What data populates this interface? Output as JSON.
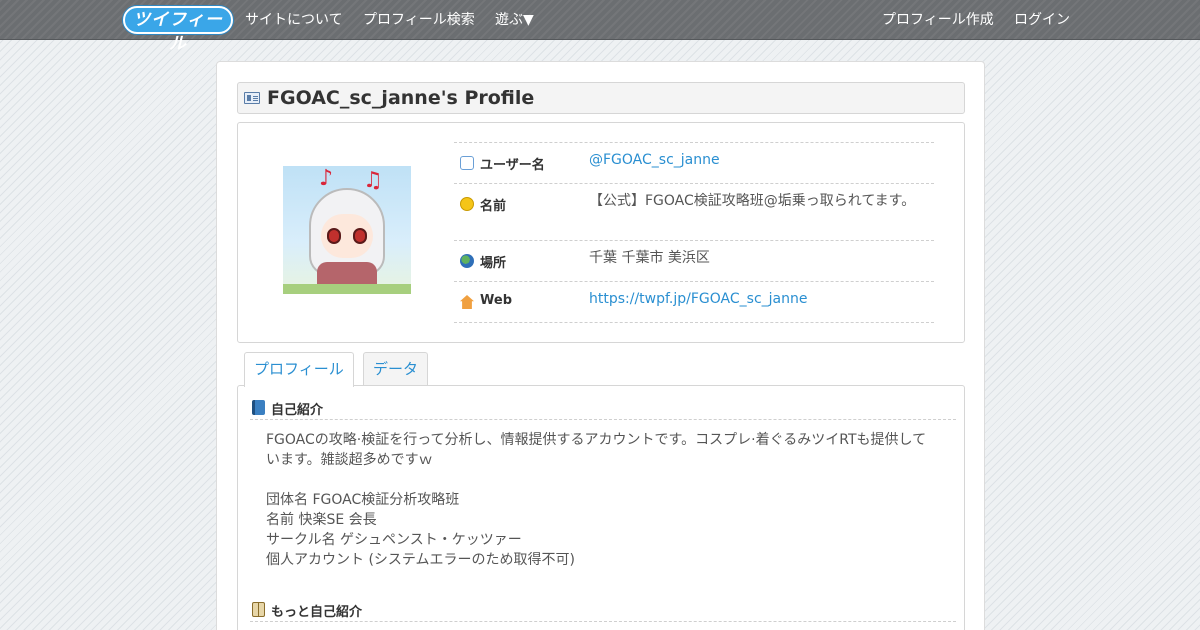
{
  "header": {
    "logo": "ツイフィール",
    "nav": {
      "about": "サイトについて",
      "search": "プロフィール検索",
      "play": "遊ぶ▼",
      "create": "プロフィール作成",
      "login": "ログイン"
    }
  },
  "profile": {
    "title": "FGOAC_sc_janne's Profile",
    "fields": {
      "username_label": "ユーザー名",
      "username_value": "@FGOAC_sc_janne",
      "name_label": "名前",
      "name_value": "【公式】FGOAC検証攻略班@垢乗っ取られてます。",
      "location_label": "場所",
      "location_value": "千葉 千葉市 美浜区",
      "web_label": "Web",
      "web_value": "https://twpf.jp/FGOAC_sc_janne"
    }
  },
  "tabs": {
    "profile": "プロフィール",
    "data": "データ"
  },
  "intro": {
    "heading": "自己紹介",
    "line1": "FGOACの攻略·検証を行って分析し、情報提供するアカウントです。コスプレ·着ぐるみツイRTも提供しています。雑談超多めですｗ",
    "line2": "団体名 FGOAC検証分析攻略班",
    "line3": "名前 快楽SE 会長",
    "line4": "サークル名 ゲシュペンスト・ケッツァー",
    "line5": "個人アカウント (システムエラーのため取得不可)"
  },
  "more": {
    "heading": "もっと自己紹介"
  }
}
